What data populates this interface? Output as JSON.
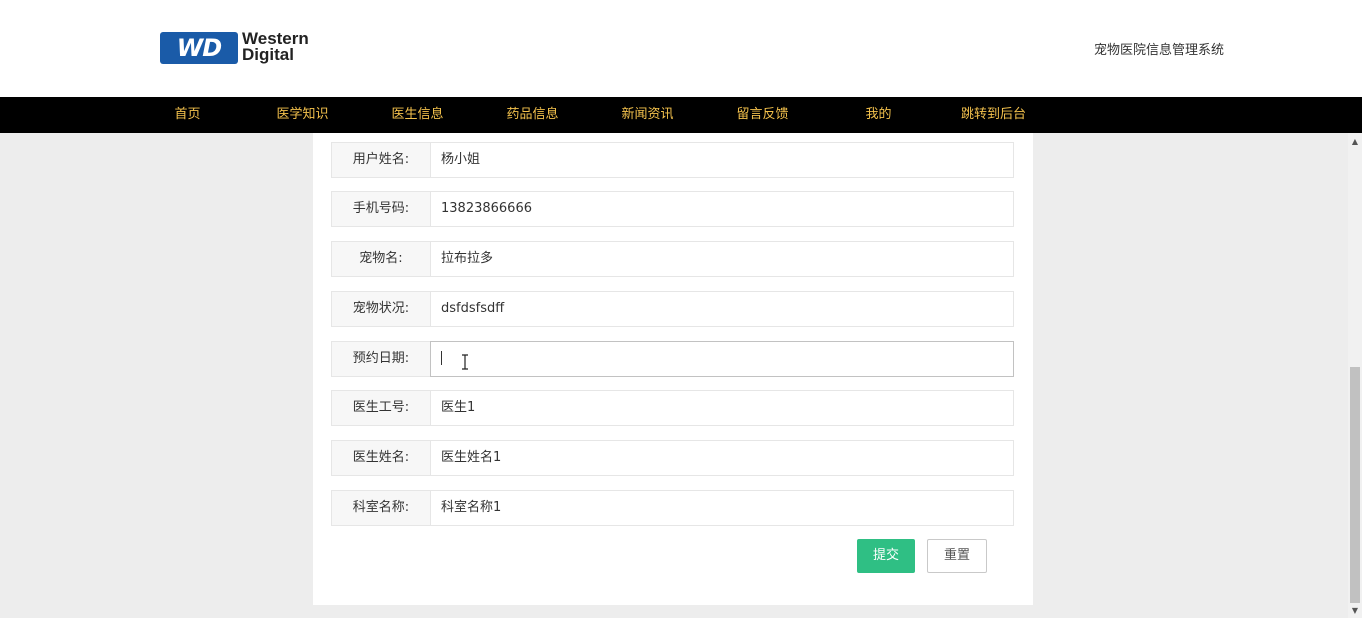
{
  "header": {
    "logo_mark": "WD",
    "logo_line1": "Western",
    "logo_line2": "Digital",
    "site_title": "宠物医院信息管理系统"
  },
  "nav": {
    "items": [
      {
        "label": "首页"
      },
      {
        "label": "医学知识"
      },
      {
        "label": "医生信息"
      },
      {
        "label": "药品信息"
      },
      {
        "label": "新闻资讯"
      },
      {
        "label": "留言反馈"
      },
      {
        "label": "我的"
      },
      {
        "label": "跳转到后台"
      }
    ]
  },
  "form": {
    "fields": [
      {
        "label": "用户姓名:",
        "value": "杨小姐"
      },
      {
        "label": "手机号码:",
        "value": "13823866666"
      },
      {
        "label": "宠物名:",
        "value": "拉布拉多"
      },
      {
        "label": "宠物状况:",
        "value": "dsfdsfsdff"
      },
      {
        "label": "预约日期:",
        "value": ""
      },
      {
        "label": "医生工号:",
        "value": "医生1"
      },
      {
        "label": "医生姓名:",
        "value": "医生姓名1"
      },
      {
        "label": "科室名称:",
        "value": "科室名称1"
      }
    ],
    "submit_label": "提交",
    "reset_label": "重置"
  },
  "colors": {
    "nav_bg": "#000000",
    "nav_text": "#f4c24d",
    "submit_bg": "#2fbf84",
    "logo_blue": "#1a5ba8"
  }
}
